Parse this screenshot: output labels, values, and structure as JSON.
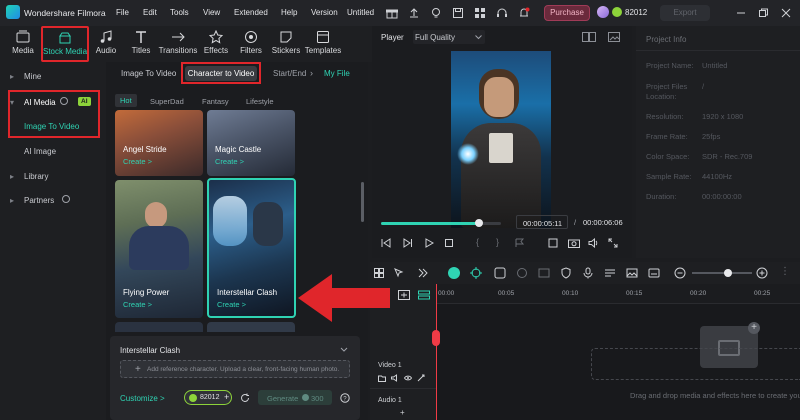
{
  "app": {
    "title": "Wondershare Filmora",
    "menu": [
      "File",
      "Edit",
      "Tools",
      "View",
      "Extended",
      "Help",
      "Version",
      "Untitled"
    ],
    "purchase_label": "Purchase",
    "credits": "82012",
    "export_label": "Export"
  },
  "toolbar": {
    "items": [
      "Media",
      "Stock Media",
      "Audio",
      "Titles",
      "Transitions",
      "Effects",
      "Filters",
      "Stickers",
      "Templates"
    ]
  },
  "sidebar": {
    "mine": "Mine",
    "ai_media": "AI Media",
    "ai_badge": "AI",
    "image_to_video": "Image To Video",
    "ai_image": "AI Image",
    "library": "Library",
    "partners": "Partners"
  },
  "library": {
    "tabs": [
      "Image To Video",
      "Character to Video",
      "Start/End",
      "My File"
    ],
    "filters": [
      "Hot",
      "SuperDad",
      "Fantasy",
      "Lifestyle"
    ],
    "cards": [
      {
        "title": "Angel Stride",
        "create": "Create >"
      },
      {
        "title": "Magic Castle",
        "create": "Create >"
      },
      {
        "title": "Flying Power",
        "create": "Create >"
      },
      {
        "title": "Interstellar Clash",
        "create": "Create >"
      }
    ],
    "panel": {
      "title": "Interstellar Clash",
      "add_ref": "Add reference character. Upload a clear, front-facing human photo.",
      "customize": "Customize >",
      "credits": "82012",
      "generate": "Generate",
      "generate_cost": "300"
    }
  },
  "player": {
    "label": "Player",
    "quality": "Full Quality",
    "current_time": "00:00:05:11",
    "separator": "/",
    "total_time": "00:00:06:06",
    "progress": 0.82
  },
  "project_info": {
    "header": "Project Info",
    "rows": [
      {
        "label": "Project Name:",
        "value": "Untitled"
      },
      {
        "label": "Project Files Location:",
        "value": "/"
      },
      {
        "label": "Resolution:",
        "value": "1920 x 1080"
      },
      {
        "label": "Frame Rate:",
        "value": "25fps"
      },
      {
        "label": "Color Space:",
        "value": "SDR - Rec.709"
      },
      {
        "label": "Sample Rate:",
        "value": "44100Hz"
      },
      {
        "label": "Duration:",
        "value": "00:00:00:00"
      }
    ]
  },
  "timeline": {
    "ruler": [
      "00:00",
      "00:05",
      "00:10",
      "00:15",
      "00:20",
      "00:25"
    ],
    "video_track": "Video 1",
    "audio_track": "Audio 1",
    "drop_hint": "Drag and drop media and effects here to create your video."
  },
  "colors": {
    "accent": "#2fd3b3",
    "annotation_red": "#e0262b",
    "purchase": "#a03b57"
  }
}
